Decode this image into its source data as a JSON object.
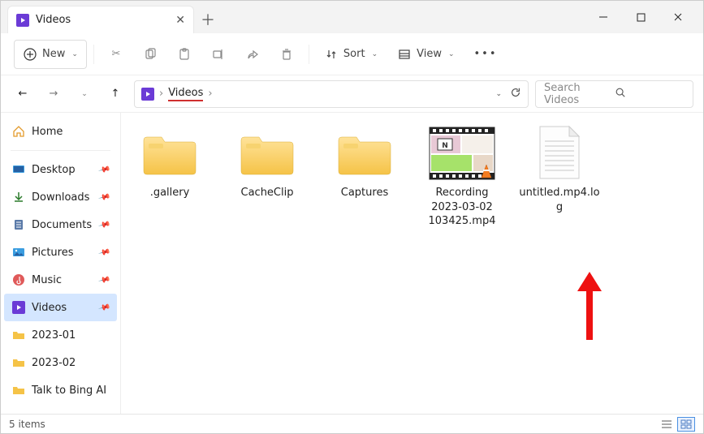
{
  "window": {
    "title": "Videos"
  },
  "toolbar": {
    "new": "New",
    "sort": "Sort",
    "view": "View"
  },
  "breadcrumb": {
    "current": "Videos"
  },
  "search": {
    "placeholder": "Search Videos"
  },
  "sidebar": {
    "home": "Home",
    "items": [
      {
        "label": "Desktop",
        "pinned": true
      },
      {
        "label": "Downloads",
        "pinned": true
      },
      {
        "label": "Documents",
        "pinned": true
      },
      {
        "label": "Pictures",
        "pinned": true
      },
      {
        "label": "Music",
        "pinned": true
      },
      {
        "label": "Videos",
        "pinned": true,
        "active": true
      },
      {
        "label": "2023-01",
        "pinned": false
      },
      {
        "label": "2023-02",
        "pinned": false
      },
      {
        "label": "Talk to Bing AI",
        "pinned": false
      }
    ]
  },
  "files": [
    {
      "name": ".gallery",
      "type": "folder"
    },
    {
      "name": "CacheClip",
      "type": "folder"
    },
    {
      "name": "Captures",
      "type": "folder"
    },
    {
      "name": "Recording 2023-03-02 103425.mp4",
      "type": "video"
    },
    {
      "name": "untitled.mp4.log",
      "type": "text"
    }
  ],
  "status": {
    "count": "5 items"
  }
}
